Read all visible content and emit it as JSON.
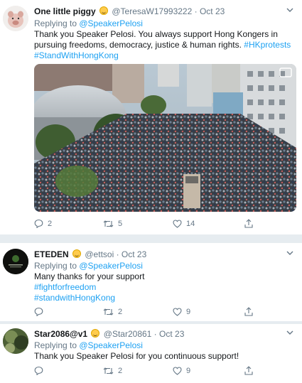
{
  "tweets": [
    {
      "name": "One little piggy",
      "handle": "@TeresaW17993222",
      "date": "Oct 23",
      "replying_label": "Replying to ",
      "replying_handle": "@SpeakerPelosi",
      "text_lines": [
        "Thank you Speaker Pelosi. You always support Hong Kongers in",
        "pursuing freedoms, democracy, justice & human rights."
      ],
      "hashtags": [
        "#HKprotests",
        "#StandWithHongKong"
      ],
      "replies": "2",
      "retweets": "5",
      "likes": "14"
    },
    {
      "name": "ETEDEN",
      "handle": "@ettsoi",
      "date": "Oct 23",
      "replying_label": "Replying to ",
      "replying_handle": "@SpeakerPelosi",
      "text_lines": [
        "Many thanks for your support"
      ],
      "hashtags": [
        "#fightforfreedom",
        "#standwithHongKong"
      ],
      "replies": "",
      "retweets": "2",
      "likes": "9"
    },
    {
      "name": "Star2086@v1",
      "handle": "@Star20861",
      "date": "Oct 23",
      "replying_label": "Replying to ",
      "replying_handle": "@SpeakerPelosi",
      "text_lines": [
        "Thank you Speaker Pelosi for you continuous support!"
      ],
      "hashtags": [],
      "replies": "",
      "retweets": "2",
      "likes": "9"
    }
  ],
  "separator": " · ",
  "icons": {
    "reply": "reply-icon",
    "retweet": "retweet-icon",
    "like": "heart-icon",
    "share": "share-icon",
    "more": "chevron-down-icon",
    "gif": "media-badge-icon"
  },
  "colors": {
    "link": "#1da1f2",
    "meta": "#657786",
    "background": "#e6ecf0"
  }
}
